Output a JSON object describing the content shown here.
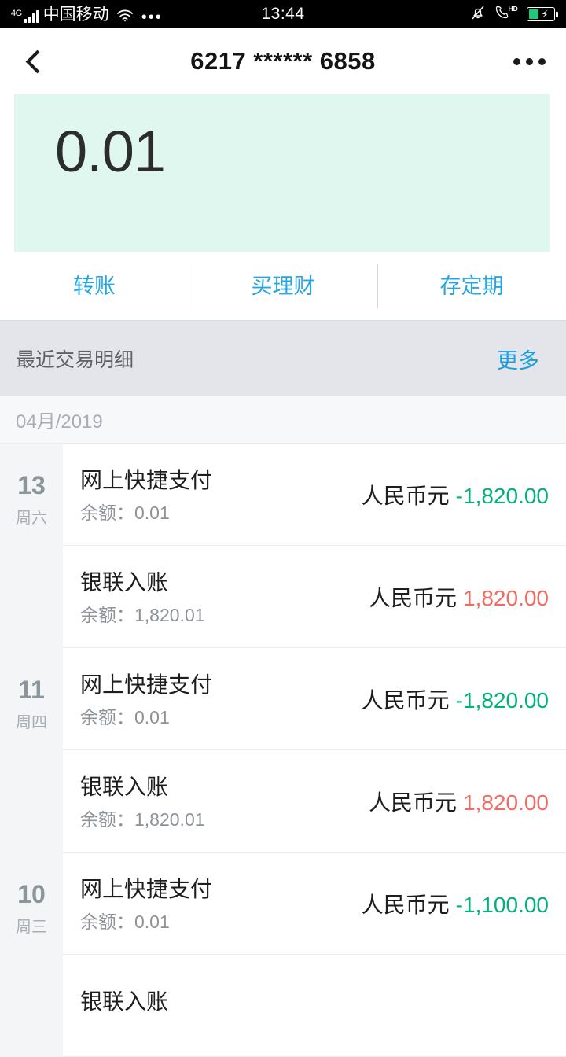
{
  "status_bar": {
    "network_type": "4G",
    "carrier": "中国移动",
    "wifi_icon": "wifi-icon",
    "ellipsis": "•••",
    "time": "13:44",
    "mute_icon": "bell-muted-icon",
    "hd_call_icon": "hd-call-icon",
    "battery_icon": "battery-charging-icon"
  },
  "header": {
    "back_icon": "back-chevron-icon",
    "title": "6217 ****** 6858",
    "more_icon": "more-options-icon"
  },
  "balance_card": {
    "amount": "0.01",
    "background_color": "#e0f7ef"
  },
  "actions": [
    {
      "label": "转账"
    },
    {
      "label": "买理财"
    },
    {
      "label": "存定期"
    }
  ],
  "transactions_section": {
    "title": "最近交易明细",
    "more_label": "更多",
    "month_label": "04月/2019",
    "groups": [
      {
        "day": "13",
        "weekday": "周六",
        "rows": [
          {
            "title": "网上快捷支付",
            "balance_label": "余额：0.01",
            "currency": "人民币元",
            "amount": "-1,820.00",
            "direction": "negative"
          },
          {
            "title": "银联入账",
            "balance_label": "余额：1,820.01",
            "currency": "人民币元",
            "amount": "1,820.00",
            "direction": "positive"
          }
        ]
      },
      {
        "day": "11",
        "weekday": "周四",
        "rows": [
          {
            "title": "网上快捷支付",
            "balance_label": "余额：0.01",
            "currency": "人民币元",
            "amount": "-1,820.00",
            "direction": "negative"
          },
          {
            "title": "银联入账",
            "balance_label": "余额：1,820.01",
            "currency": "人民币元",
            "amount": "1,820.00",
            "direction": "positive"
          }
        ]
      },
      {
        "day": "10",
        "weekday": "周三",
        "rows": [
          {
            "title": "网上快捷支付",
            "balance_label": "余额：0.01",
            "currency": "人民币元",
            "amount": "-1,100.00",
            "direction": "negative"
          },
          {
            "title": "银联入账",
            "balance_label": "",
            "currency": "",
            "amount": "",
            "direction": "positive"
          }
        ]
      }
    ]
  },
  "colors": {
    "accent_blue": "#26a5e4",
    "link_blue": "#1a9ee0",
    "amount_negative": "#00b277",
    "amount_positive": "#f26b62",
    "card_mint": "#e0f7ef",
    "section_gray": "#e3e5ea"
  }
}
